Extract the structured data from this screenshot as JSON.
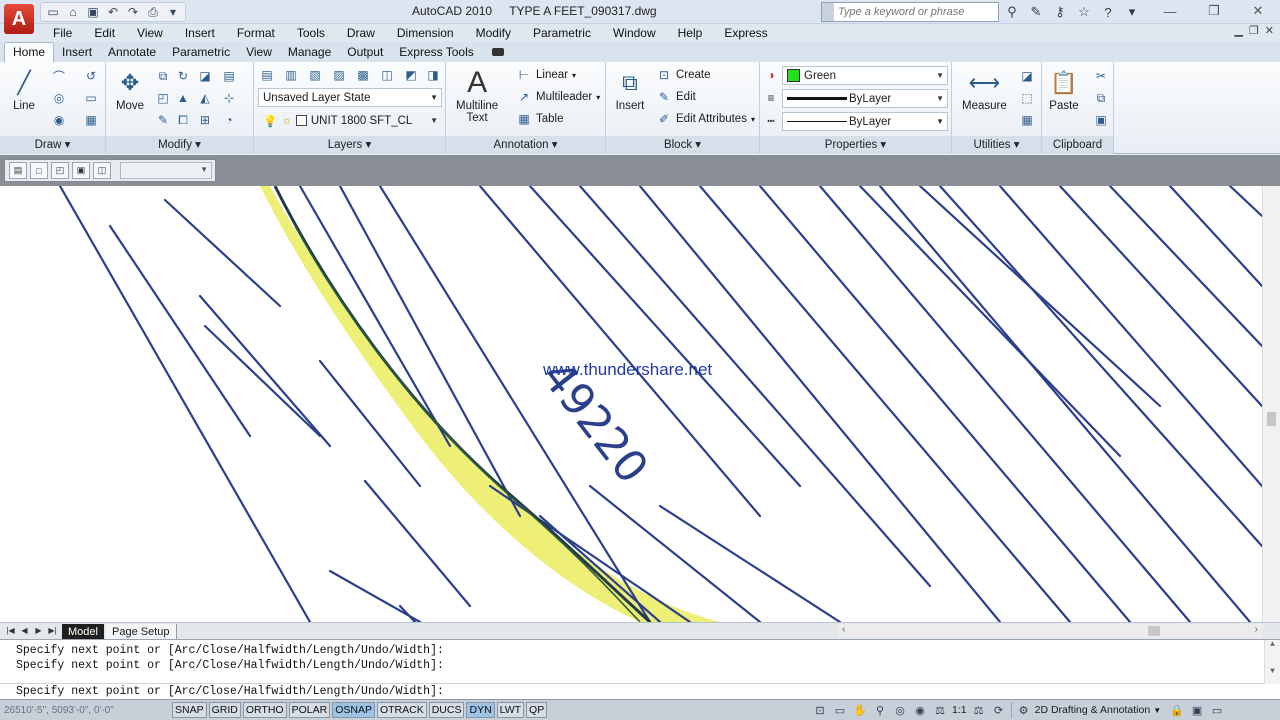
{
  "title_bar": {
    "app_name": "AutoCAD 2010",
    "file_name": "TYPE A FEET_090317.dwg",
    "search_placeholder": "Type a keyword or phrase",
    "app_logo": "A"
  },
  "menu": [
    "File",
    "Edit",
    "View",
    "Insert",
    "Format",
    "Tools",
    "Draw",
    "Dimension",
    "Modify",
    "Parametric",
    "Window",
    "Help",
    "Express"
  ],
  "ribbon_tabs": [
    "Home",
    "Insert",
    "Annotate",
    "Parametric",
    "View",
    "Manage",
    "Output",
    "Express Tools"
  ],
  "ribbon": {
    "draw": {
      "title": "Draw",
      "line_label": "Line"
    },
    "modify": {
      "title": "Modify",
      "move_label": "Move"
    },
    "layers": {
      "title": "Layers",
      "layer_state": "Unsaved Layer State",
      "current_layer": "UNIT 1800 SFT_CL"
    },
    "annotation": {
      "title": "Annotation",
      "multiline_text_line1": "Multiline",
      "multiline_text_line2": "Text",
      "linear": "Linear",
      "multileader": "Multileader",
      "table": "Table"
    },
    "block": {
      "title": "Block",
      "insert": "Insert",
      "create": "Create",
      "edit": "Edit",
      "edit_attributes": "Edit Attributes"
    },
    "properties": {
      "title": "Properties",
      "color": "Green",
      "color_hex": "#22e01f",
      "linetype": "ByLayer",
      "lineweight": "ByLayer"
    },
    "utilities": {
      "title": "Utilities",
      "measure": "Measure"
    },
    "clipboard": {
      "title": "Clipboard",
      "paste": "Paste"
    }
  },
  "drawing": {
    "watermark": "www.thundershare.net",
    "contour_label": "49220",
    "line_color": "#2b3f8a",
    "highlight_color": "#e8ea4a"
  },
  "layout_tabs": [
    "Model",
    "Page Setup"
  ],
  "command_line": {
    "history": [
      "Specify next point or [Arc/Close/Halfwidth/Length/Undo/Width]:",
      "Specify next point or [Arc/Close/Halfwidth/Length/Undo/Width]:"
    ],
    "prompt": "Specify next point or [Arc/Close/Halfwidth/Length/Undo/Width]:"
  },
  "status_bar": {
    "coordinates": "26510'-5\", 5093'-0\", 0'-0\"",
    "toggles": [
      {
        "label": "SNAP",
        "on": false
      },
      {
        "label": "GRID",
        "on": false
      },
      {
        "label": "ORTHO",
        "on": false
      },
      {
        "label": "POLAR",
        "on": false
      },
      {
        "label": "OSNAP",
        "on": true
      },
      {
        "label": "OTRACK",
        "on": false
      },
      {
        "label": "DUCS",
        "on": false
      },
      {
        "label": "DYN",
        "on": true
      },
      {
        "label": "LWT",
        "on": false
      },
      {
        "label": "QP",
        "on": false
      }
    ],
    "scale": "1:1",
    "workspace": "2D Drafting & Annotation"
  }
}
